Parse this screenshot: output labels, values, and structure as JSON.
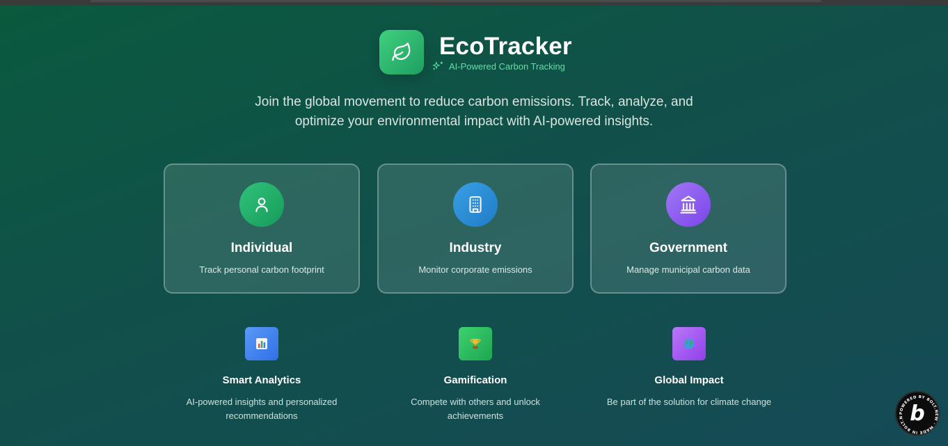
{
  "brand": {
    "title": "EcoTracker",
    "subtitle": "AI-Powered Carbon Tracking",
    "logo_icon": "leaf-icon",
    "subtitle_icon": "sparkles-icon"
  },
  "tagline_line1": "Join the global movement to reduce carbon emissions. Track, analyze, and",
  "tagline_line2": "optimize your environmental impact with AI-powered insights.",
  "cards": [
    {
      "title": "Individual",
      "description": "Track personal carbon footprint",
      "icon": "user-icon",
      "color": "#22b36b"
    },
    {
      "title": "Industry",
      "description": "Monitor corporate emissions",
      "icon": "building-icon",
      "color": "#2f8fd8"
    },
    {
      "title": "Government",
      "description": "Manage municipal carbon data",
      "icon": "landmark-icon",
      "color": "#8b5cf6"
    }
  ],
  "features": [
    {
      "title": "Smart Analytics",
      "description_line1": "AI-powered insights and personalized",
      "description_line2": "recommendations",
      "icon": "bar-chart-emoji-icon",
      "color": "#3b82f6"
    },
    {
      "title": "Gamification",
      "description_line1": "Compete with others and unlock",
      "description_line2": "achievements",
      "icon": "trophy-emoji-icon",
      "color": "#22c55e"
    },
    {
      "title": "Global Impact",
      "description_line1": "Be part of the solution for climate change",
      "description_line2": "",
      "icon": "globe-emoji-icon",
      "color": "#a855f7"
    }
  ],
  "badge": {
    "letter": "b",
    "ring_text": "POWERED BY BOLT.NEW · MADE IN BOLT.NEW ·"
  }
}
